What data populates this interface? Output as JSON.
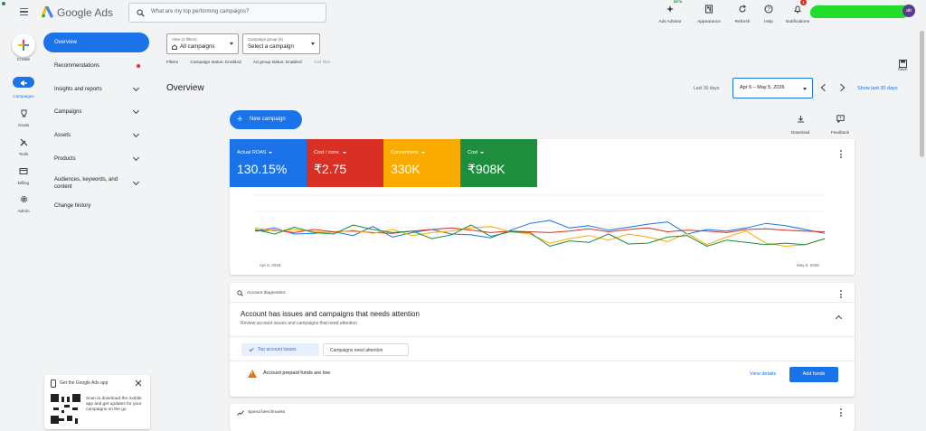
{
  "app": {
    "name": "Google Ads"
  },
  "search": {
    "placeholder": "What are my top performing campaigns?"
  },
  "toolbar": {
    "items": [
      {
        "label": "Ads Advisor",
        "badge": "BETA"
      },
      {
        "label": "Appearance"
      },
      {
        "label": "Refresh"
      },
      {
        "label": "Help"
      },
      {
        "label": "Notifications",
        "count": "1"
      }
    ],
    "avatar_initials": "ab"
  },
  "rail": {
    "create_label": "Create",
    "items": [
      "Campaigns",
      "Goals",
      "Tools",
      "Billing",
      "Admin"
    ]
  },
  "nav": {
    "items": [
      {
        "label": "Overview"
      },
      {
        "label": "Recommendations"
      },
      {
        "label": "Insights and reports"
      },
      {
        "label": "Campaigns"
      },
      {
        "label": "Assets"
      },
      {
        "label": "Products"
      },
      {
        "label": "Audiences, keywords, and content"
      },
      {
        "label": "Change history"
      }
    ]
  },
  "app_promo": {
    "title": "Get the Google Ads app",
    "text": "Scan to download the mobile app and get updates for your campaigns on the go"
  },
  "filters": {
    "view_label": "View (2 filters)",
    "view_value": "All campaigns",
    "campaign_group_label": "Campaign group (5)",
    "campaign_group_value": "Select a campaign",
    "filters_label": "Filters",
    "chips": [
      "Campaign status: Enabled",
      "Ad group status: Enabled",
      "Add filter"
    ]
  },
  "save_label": "Save",
  "overview": {
    "title": "Overview",
    "date_prefix": "Last 30 days",
    "date_range": "Apr 6 – May 5, 2026",
    "show_last": "Show last 30 days",
    "new_campaign": "New campaign",
    "download": "Download",
    "feedback": "Feedback"
  },
  "metrics": [
    {
      "label": "Actual ROAS",
      "value": "130.15%",
      "color": "#1a73e8"
    },
    {
      "label": "Cost / conv.",
      "value": "₹2.75",
      "color": "#d93025"
    },
    {
      "label": "Conversions",
      "value": "330K",
      "color": "#f9ab00"
    },
    {
      "label": "Cost",
      "value": "₹908K",
      "color": "#1e8e3e"
    }
  ],
  "chart_data": {
    "type": "line",
    "x_start_label": "Apr 6, 2026",
    "x_end_label": "May 5, 2026",
    "grid": true,
    "series": [
      {
        "color": "#1a73e8",
        "values": [
          48,
          52,
          44,
          45,
          47,
          42,
          54,
          40,
          46,
          50,
          44,
          43,
          39,
          49,
          58,
          62,
          52,
          55,
          49,
          53,
          57,
          60,
          44,
          50,
          48,
          52,
          58,
          55,
          50,
          45
        ]
      },
      {
        "color": "#d93025",
        "values": [
          48,
          49,
          46,
          50,
          47,
          48,
          46,
          45,
          48,
          50,
          52,
          49,
          46,
          48,
          47,
          46,
          48,
          51,
          47,
          50,
          52,
          47,
          49,
          48,
          46,
          50,
          51,
          49,
          48,
          47
        ]
      },
      {
        "color": "#f9ab00",
        "values": [
          52,
          48,
          50,
          47,
          46,
          49,
          45,
          50,
          42,
          46,
          48,
          52,
          54,
          47,
          44,
          32,
          38,
          42,
          36,
          44,
          40,
          34,
          45,
          30,
          40,
          48,
          32,
          28,
          30,
          38
        ]
      },
      {
        "color": "#1e8e3e",
        "values": [
          50,
          44,
          53,
          46,
          44,
          56,
          50,
          46,
          48,
          38,
          43,
          56,
          41,
          47,
          46,
          28,
          35,
          33,
          44,
          31,
          32,
          40,
          42,
          28,
          36,
          33,
          30,
          32,
          30,
          38
        ]
      }
    ]
  },
  "diagnostics": {
    "section": "Account diagnostics",
    "headline": "Account has issues and campaigns that needs attention",
    "sub": "Review account issues and campaigns that need attention",
    "tabs": [
      "Top account issues",
      "Campaigns need attention"
    ],
    "issue": "Account prepaid funds are low",
    "view_details": "View details",
    "add_funds": "Add funds"
  },
  "benchmarks": {
    "section": "Spend benchmarks"
  }
}
